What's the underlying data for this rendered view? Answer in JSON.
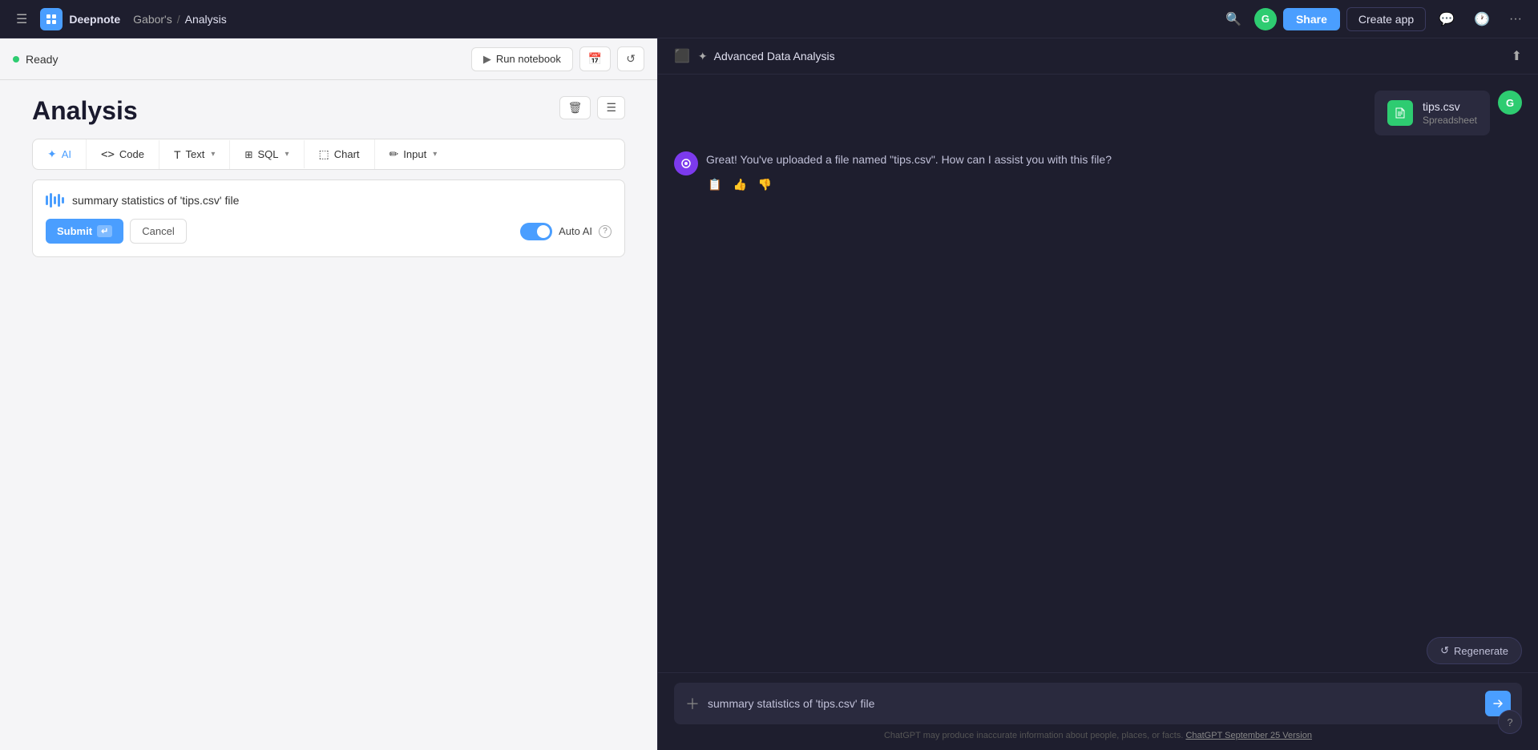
{
  "topbar": {
    "menu_icon": "☰",
    "app_name": "Deepnote",
    "breadcrumb_parent": "Gabor's",
    "breadcrumb_sep": "/",
    "breadcrumb_current": "Analysis",
    "user_initial": "G",
    "share_label": "Share",
    "create_app_label": "Create app",
    "search_icon": "🔍",
    "history_icon": "🕐",
    "more_icon": "···"
  },
  "notebook": {
    "status": {
      "dot_color": "#2ecc71",
      "text": "Ready"
    },
    "run_btn_label": "Run notebook",
    "calendar_icon": "📅",
    "refresh_icon": "↺",
    "title": "Analysis",
    "delete_icon": "🗑",
    "menu_icon": "☰"
  },
  "cell_toolbar": {
    "tools": [
      {
        "id": "ai",
        "icon": "✦",
        "label": "AI",
        "active": true
      },
      {
        "id": "code",
        "icon": "<>",
        "label": "Code",
        "active": false
      },
      {
        "id": "text",
        "icon": "T",
        "label": "Text",
        "active": false,
        "has_chevron": true
      },
      {
        "id": "sql",
        "icon": "⊞",
        "label": "SQL",
        "active": false,
        "has_chevron": true
      },
      {
        "id": "chart",
        "icon": "⬚",
        "label": "Chart",
        "active": false
      },
      {
        "id": "input",
        "icon": "✏",
        "label": "Input",
        "active": false,
        "has_chevron": true
      }
    ]
  },
  "ai_cell": {
    "input_text": "summary statistics of 'tips.csv' file",
    "submit_label": "Submit",
    "enter_icon": "↵",
    "cancel_label": "Cancel",
    "auto_ai_label": "Auto AI",
    "toggle_on": true
  },
  "ai_panel": {
    "title": "Advanced Data Analysis",
    "user_initial": "G",
    "file": {
      "name": "tips.csv",
      "type": "Spreadsheet"
    },
    "ai_message": "Great! You've uploaded a file named \"tips.csv\". How can I assist you with this file?",
    "regenerate_label": "Regenerate",
    "chat_input": "summary statistics of 'tips.csv' file",
    "footer_note": "ChatGPT may produce inaccurate information about people, places, or facts.",
    "footer_link_text": "ChatGPT September 25 Version"
  }
}
